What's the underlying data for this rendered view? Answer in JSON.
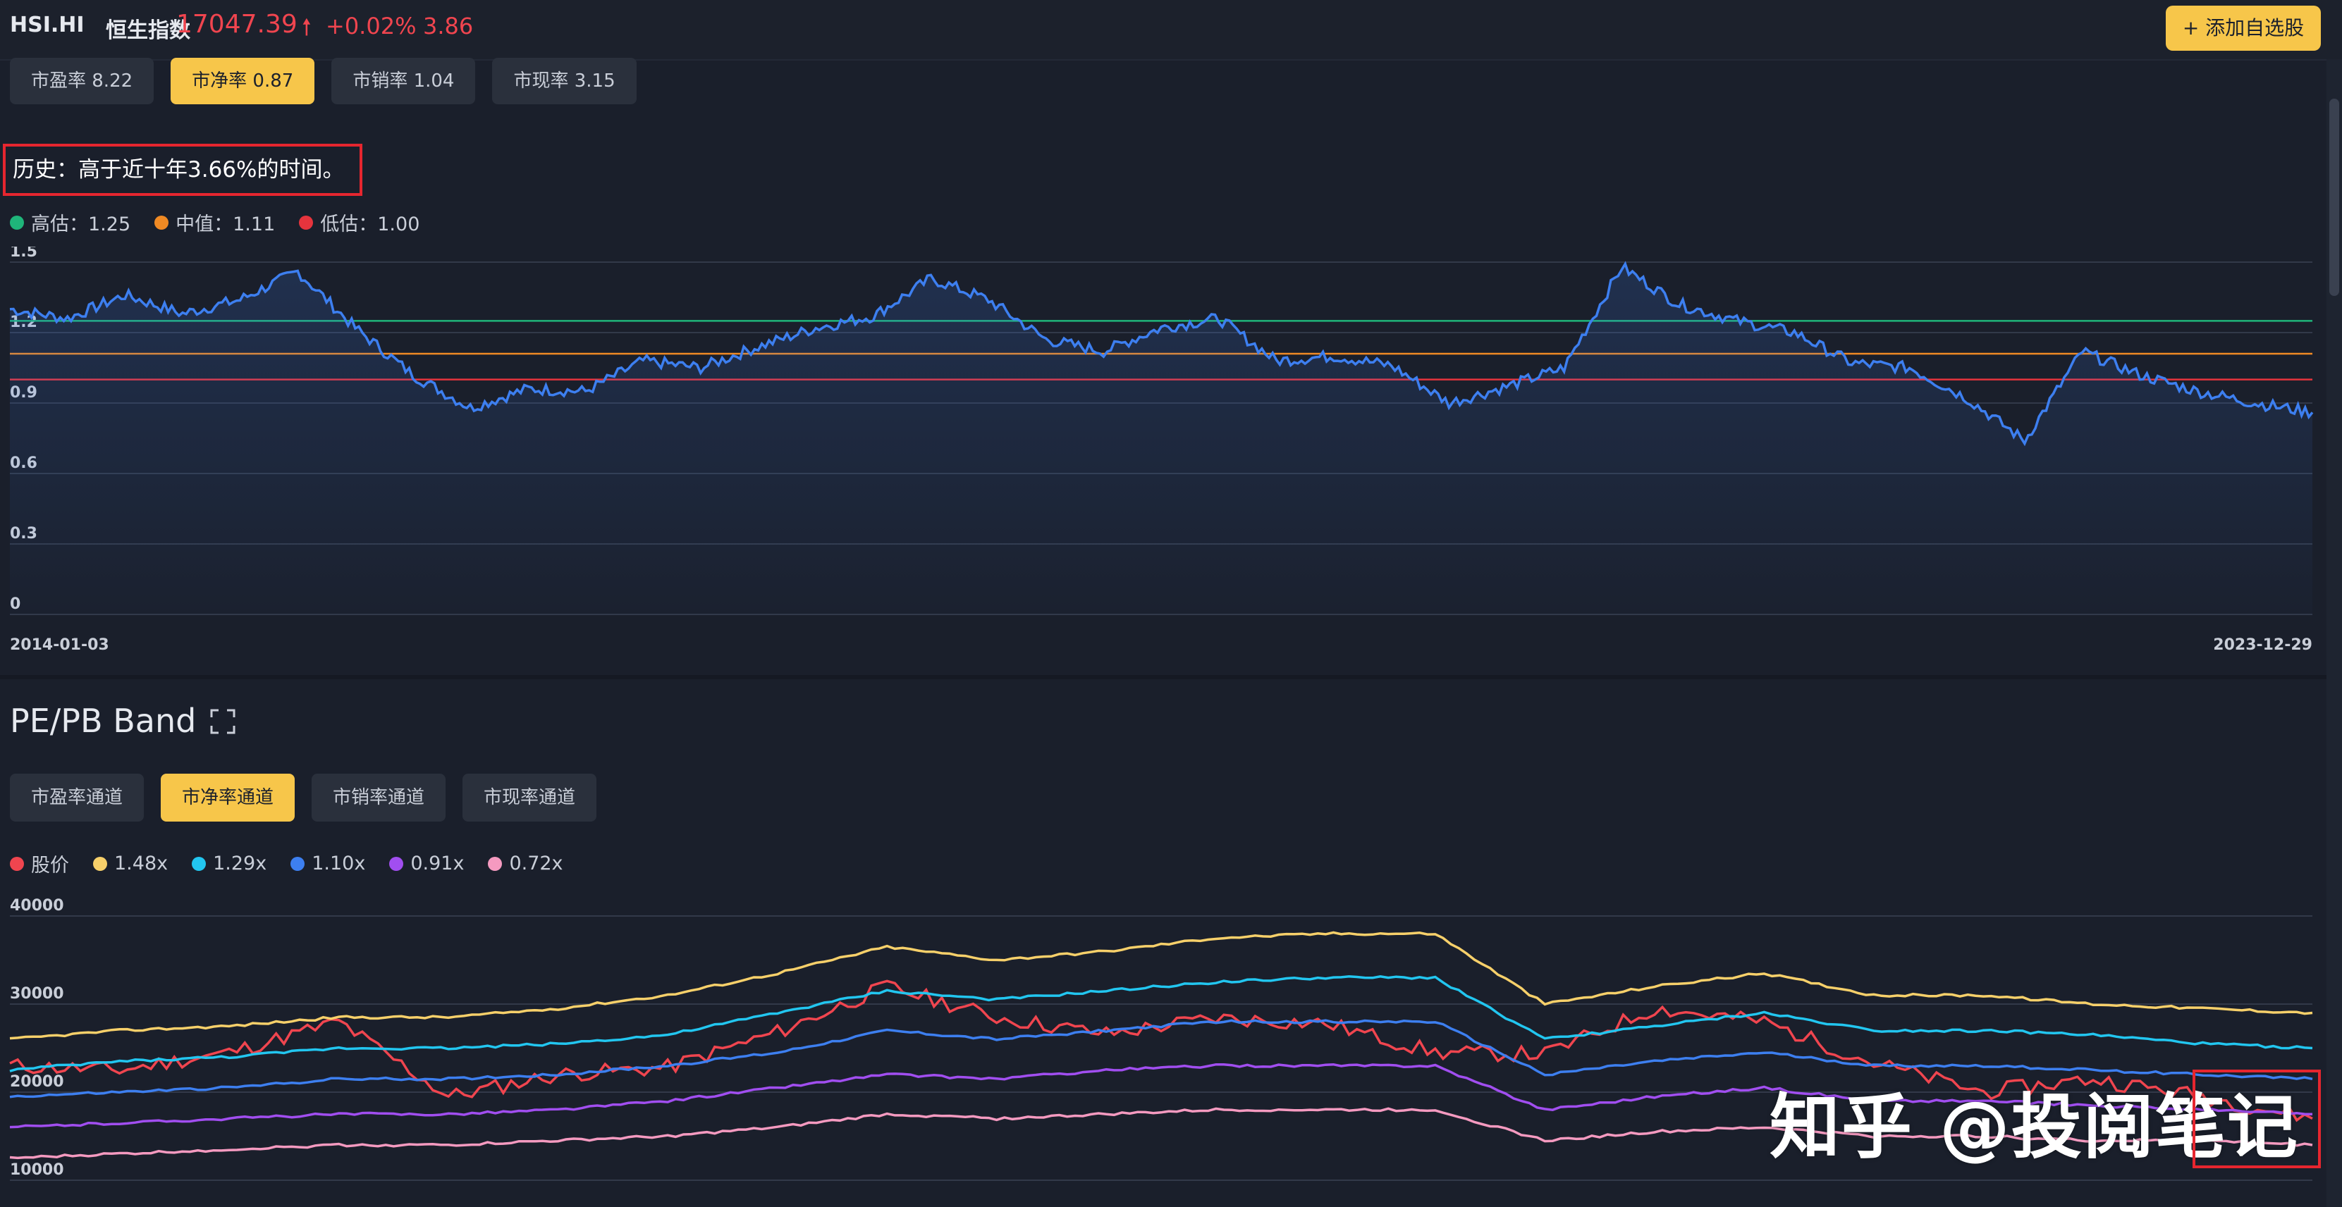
{
  "header": {
    "ticker": "HSI.HI",
    "name": "恒生指数",
    "price": "17047.39",
    "change": "+0.02%",
    "metric": "3.86",
    "add_button": "+ 添加自选股"
  },
  "valuation_tabs": [
    {
      "label": "市盈率 8.22",
      "active": false
    },
    {
      "label": "市净率 0.87",
      "active": true
    },
    {
      "label": "市销率 1.04",
      "active": false
    },
    {
      "label": "市现率 3.15",
      "active": false
    }
  ],
  "history_text": "历史：高于近十年3.66%的时间。",
  "valuation_legend": [
    {
      "label": "高估：1.25",
      "color": "#1fb57a"
    },
    {
      "label": "中值：1.11",
      "color": "#f08a24"
    },
    {
      "label": "低估：1.00",
      "color": "#e6343d"
    }
  ],
  "band_title": "PE/PB Band",
  "band_tabs": [
    {
      "label": "市盈率通道",
      "active": false
    },
    {
      "label": "市净率通道",
      "active": true
    },
    {
      "label": "市销率通道",
      "active": false
    },
    {
      "label": "市现率通道",
      "active": false
    }
  ],
  "band_legend": [
    {
      "label": "股价",
      "color": "#f0454f"
    },
    {
      "label": "1.48x",
      "color": "#f7d06a"
    },
    {
      "label": "1.29x",
      "color": "#22c6f0"
    },
    {
      "label": "1.10x",
      "color": "#3d7ff0"
    },
    {
      "label": "0.91x",
      "color": "#a14ef0"
    },
    {
      "label": "0.72x",
      "color": "#f59ac0"
    }
  ],
  "watermark": "知乎 @投阅笔记",
  "chart_data": [
    {
      "type": "line",
      "title": "",
      "ylim": [
        0,
        1.5
      ],
      "yticks": [
        "1.5",
        "1.2",
        "0.9",
        "0.6",
        "0.3",
        "0"
      ],
      "x_start": "2014-01-03",
      "x_end": "2023-12-29",
      "reference_lines": [
        {
          "name": "高估",
          "value": 1.25,
          "color": "#1fb57a"
        },
        {
          "name": "中值",
          "value": 1.11,
          "color": "#f08a24"
        },
        {
          "name": "低估",
          "value": 1.0,
          "color": "#e6343d"
        }
      ],
      "line_color": "#3d7ff0",
      "x": [
        "2014-01",
        "2014-04",
        "2014-07",
        "2014-10",
        "2015-01",
        "2015-04",
        "2015-07",
        "2015-10",
        "2016-01",
        "2016-04",
        "2016-07",
        "2016-10",
        "2017-01",
        "2017-04",
        "2017-07",
        "2017-10",
        "2018-01",
        "2018-04",
        "2018-07",
        "2018-10",
        "2019-01",
        "2019-04",
        "2019-07",
        "2019-10",
        "2020-01",
        "2020-04",
        "2020-07",
        "2020-10",
        "2021-01",
        "2021-04",
        "2021-07",
        "2021-10",
        "2022-01",
        "2022-04",
        "2022-07",
        "2022-10",
        "2023-01",
        "2023-04",
        "2023-07",
        "2023-10",
        "2023-12"
      ],
      "y": [
        1.3,
        1.26,
        1.36,
        1.28,
        1.34,
        1.46,
        1.22,
        1.02,
        0.88,
        0.96,
        0.95,
        1.08,
        1.05,
        1.14,
        1.22,
        1.27,
        1.43,
        1.34,
        1.17,
        1.12,
        1.22,
        1.26,
        1.08,
        1.1,
        1.06,
        0.9,
        0.97,
        1.05,
        1.48,
        1.32,
        1.25,
        1.2,
        1.07,
        1.05,
        0.92,
        0.74,
        1.12,
        1.02,
        0.95,
        0.9,
        0.86
      ]
    },
    {
      "type": "line",
      "title": "",
      "ylim": [
        10000,
        40000
      ],
      "yticks": [
        "40000",
        "30000",
        "20000",
        "10000"
      ],
      "x": [
        "2014-01",
        "2014-07",
        "2015-01",
        "2015-07",
        "2016-01",
        "2016-07",
        "2017-01",
        "2017-07",
        "2018-01",
        "2018-07",
        "2019-01",
        "2019-07",
        "2020-01",
        "2020-07",
        "2020-10",
        "2021-01",
        "2021-07",
        "2022-01",
        "2022-07",
        "2023-01",
        "2023-07",
        "2023-12"
      ],
      "series": [
        {
          "name": "股价",
          "color": "#f0454f",
          "values": [
            23000,
            22500,
            24500,
            28000,
            19500,
            22000,
            22800,
            26800,
            32000,
            28500,
            26600,
            28400,
            27800,
            24500,
            24300,
            29500,
            28000,
            23300,
            20000,
            21500,
            19500,
            17000
          ]
        },
        {
          "name": "1.48x",
          "color": "#f7d06a",
          "values": [
            26000,
            27000,
            27500,
            28500,
            28500,
            29500,
            31000,
            33500,
            36500,
            35000,
            36000,
            37500,
            38000,
            38000,
            30000,
            32000,
            33500,
            31000,
            31000,
            30000,
            29500,
            29000
          ]
        },
        {
          "name": "1.29x",
          "color": "#22c6f0",
          "values": [
            22500,
            23500,
            24000,
            25000,
            25000,
            25500,
            26500,
            29000,
            31500,
            30500,
            31500,
            32500,
            33000,
            33000,
            26000,
            27500,
            29000,
            27000,
            27000,
            26500,
            25500,
            25000
          ]
        },
        {
          "name": "1.10x",
          "color": "#3d7ff0",
          "values": [
            19500,
            20000,
            20500,
            21500,
            21500,
            22000,
            23000,
            24500,
            27000,
            26000,
            27000,
            28000,
            28000,
            28000,
            22000,
            23500,
            24500,
            23000,
            23000,
            22500,
            22000,
            21500
          ]
        },
        {
          "name": "0.91x",
          "color": "#a14ef0",
          "values": [
            16000,
            16500,
            17000,
            17500,
            17500,
            18000,
            19000,
            20500,
            22000,
            21500,
            22500,
            23000,
            23000,
            23000,
            18000,
            19500,
            20500,
            19000,
            19000,
            18500,
            18000,
            17500
          ]
        },
        {
          "name": "0.72x",
          "color": "#f59ac0",
          "values": [
            12500,
            13000,
            13500,
            14000,
            14000,
            14500,
            15000,
            16000,
            17500,
            17000,
            17500,
            18000,
            18000,
            18000,
            14500,
            15500,
            16000,
            15000,
            15000,
            14500,
            14500,
            14000
          ]
        }
      ]
    }
  ]
}
